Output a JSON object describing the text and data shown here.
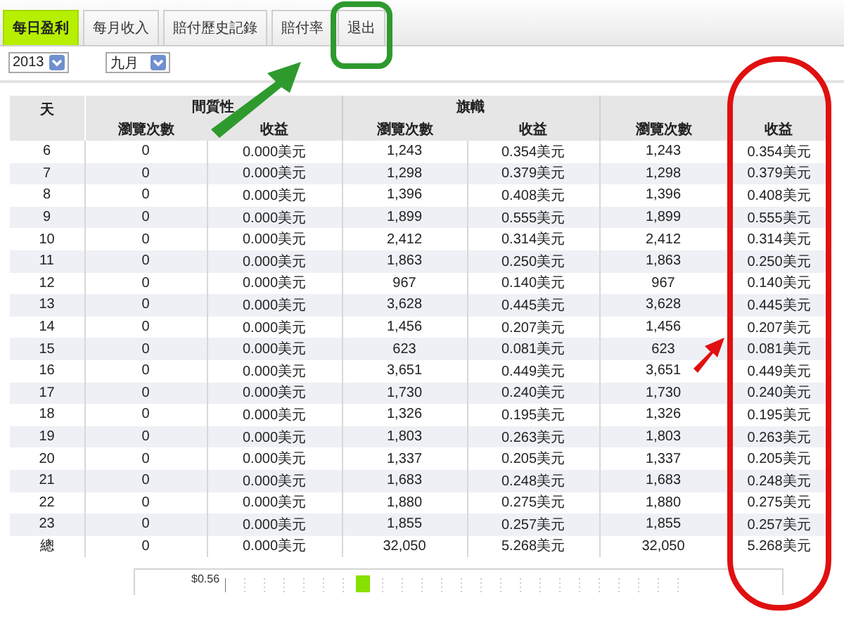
{
  "tabs": [
    {
      "label": "每日盈利",
      "selected": true
    },
    {
      "label": "每月收入",
      "selected": false
    },
    {
      "label": "賠付歷史記錄",
      "selected": false
    },
    {
      "label": "賠付率",
      "selected": false
    },
    {
      "label": "退出",
      "selected": false
    }
  ],
  "filters": [
    {
      "value": "2013"
    },
    {
      "value": "九月"
    }
  ],
  "table": {
    "first_column": "天",
    "groups": [
      {
        "label": "間質性",
        "columns": [
          "瀏覽次數",
          "收益"
        ]
      },
      {
        "label": "旗幟",
        "columns": [
          "瀏覽次數",
          "收益"
        ]
      },
      {
        "columns": [
          "瀏覽次數",
          "收益"
        ]
      }
    ],
    "rows": [
      [
        "6",
        "0",
        "0.000美元",
        "1,243",
        "0.354美元",
        "1,243",
        "0.354美元"
      ],
      [
        "7",
        "0",
        "0.000美元",
        "1,298",
        "0.379美元",
        "1,298",
        "0.379美元"
      ],
      [
        "8",
        "0",
        "0.000美元",
        "1,396",
        "0.408美元",
        "1,396",
        "0.408美元"
      ],
      [
        "9",
        "0",
        "0.000美元",
        "1,899",
        "0.555美元",
        "1,899",
        "0.555美元"
      ],
      [
        "10",
        "0",
        "0.000美元",
        "2,412",
        "0.314美元",
        "2,412",
        "0.314美元"
      ],
      [
        "11",
        "0",
        "0.000美元",
        "1,863",
        "0.250美元",
        "1,863",
        "0.250美元"
      ],
      [
        "12",
        "0",
        "0.000美元",
        "967",
        "0.140美元",
        "967",
        "0.140美元"
      ],
      [
        "13",
        "0",
        "0.000美元",
        "3,628",
        "0.445美元",
        "3,628",
        "0.445美元"
      ],
      [
        "14",
        "0",
        "0.000美元",
        "1,456",
        "0.207美元",
        "1,456",
        "0.207美元"
      ],
      [
        "15",
        "0",
        "0.000美元",
        "623",
        "0.081美元",
        "623",
        "0.081美元"
      ],
      [
        "16",
        "0",
        "0.000美元",
        "3,651",
        "0.449美元",
        "3,651",
        "0.449美元"
      ],
      [
        "17",
        "0",
        "0.000美元",
        "1,730",
        "0.240美元",
        "1,730",
        "0.240美元"
      ],
      [
        "18",
        "0",
        "0.000美元",
        "1,326",
        "0.195美元",
        "1,326",
        "0.195美元"
      ],
      [
        "19",
        "0",
        "0.000美元",
        "1,803",
        "0.263美元",
        "1,803",
        "0.263美元"
      ],
      [
        "20",
        "0",
        "0.000美元",
        "1,337",
        "0.205美元",
        "1,337",
        "0.205美元"
      ],
      [
        "21",
        "0",
        "0.000美元",
        "1,683",
        "0.248美元",
        "1,683",
        "0.248美元"
      ],
      [
        "22",
        "0",
        "0.000美元",
        "1,880",
        "0.275美元",
        "1,880",
        "0.275美元"
      ],
      [
        "23",
        "0",
        "0.000美元",
        "1,855",
        "0.257美元",
        "1,855",
        "0.257美元"
      ],
      [
        "總",
        "0",
        "0.000美元",
        "32,050",
        "5.268美元",
        "32,050",
        "5.268美元"
      ]
    ]
  },
  "chart": {
    "axis_label": "$0.56"
  },
  "annotations": [
    {
      "kind": "box",
      "color": "#2e9a2e"
    },
    {
      "kind": "arrow",
      "color": "#2e9a2e"
    },
    {
      "kind": "arrow",
      "color": "#e01010"
    },
    {
      "kind": "ring",
      "color": "#e01010"
    }
  ]
}
